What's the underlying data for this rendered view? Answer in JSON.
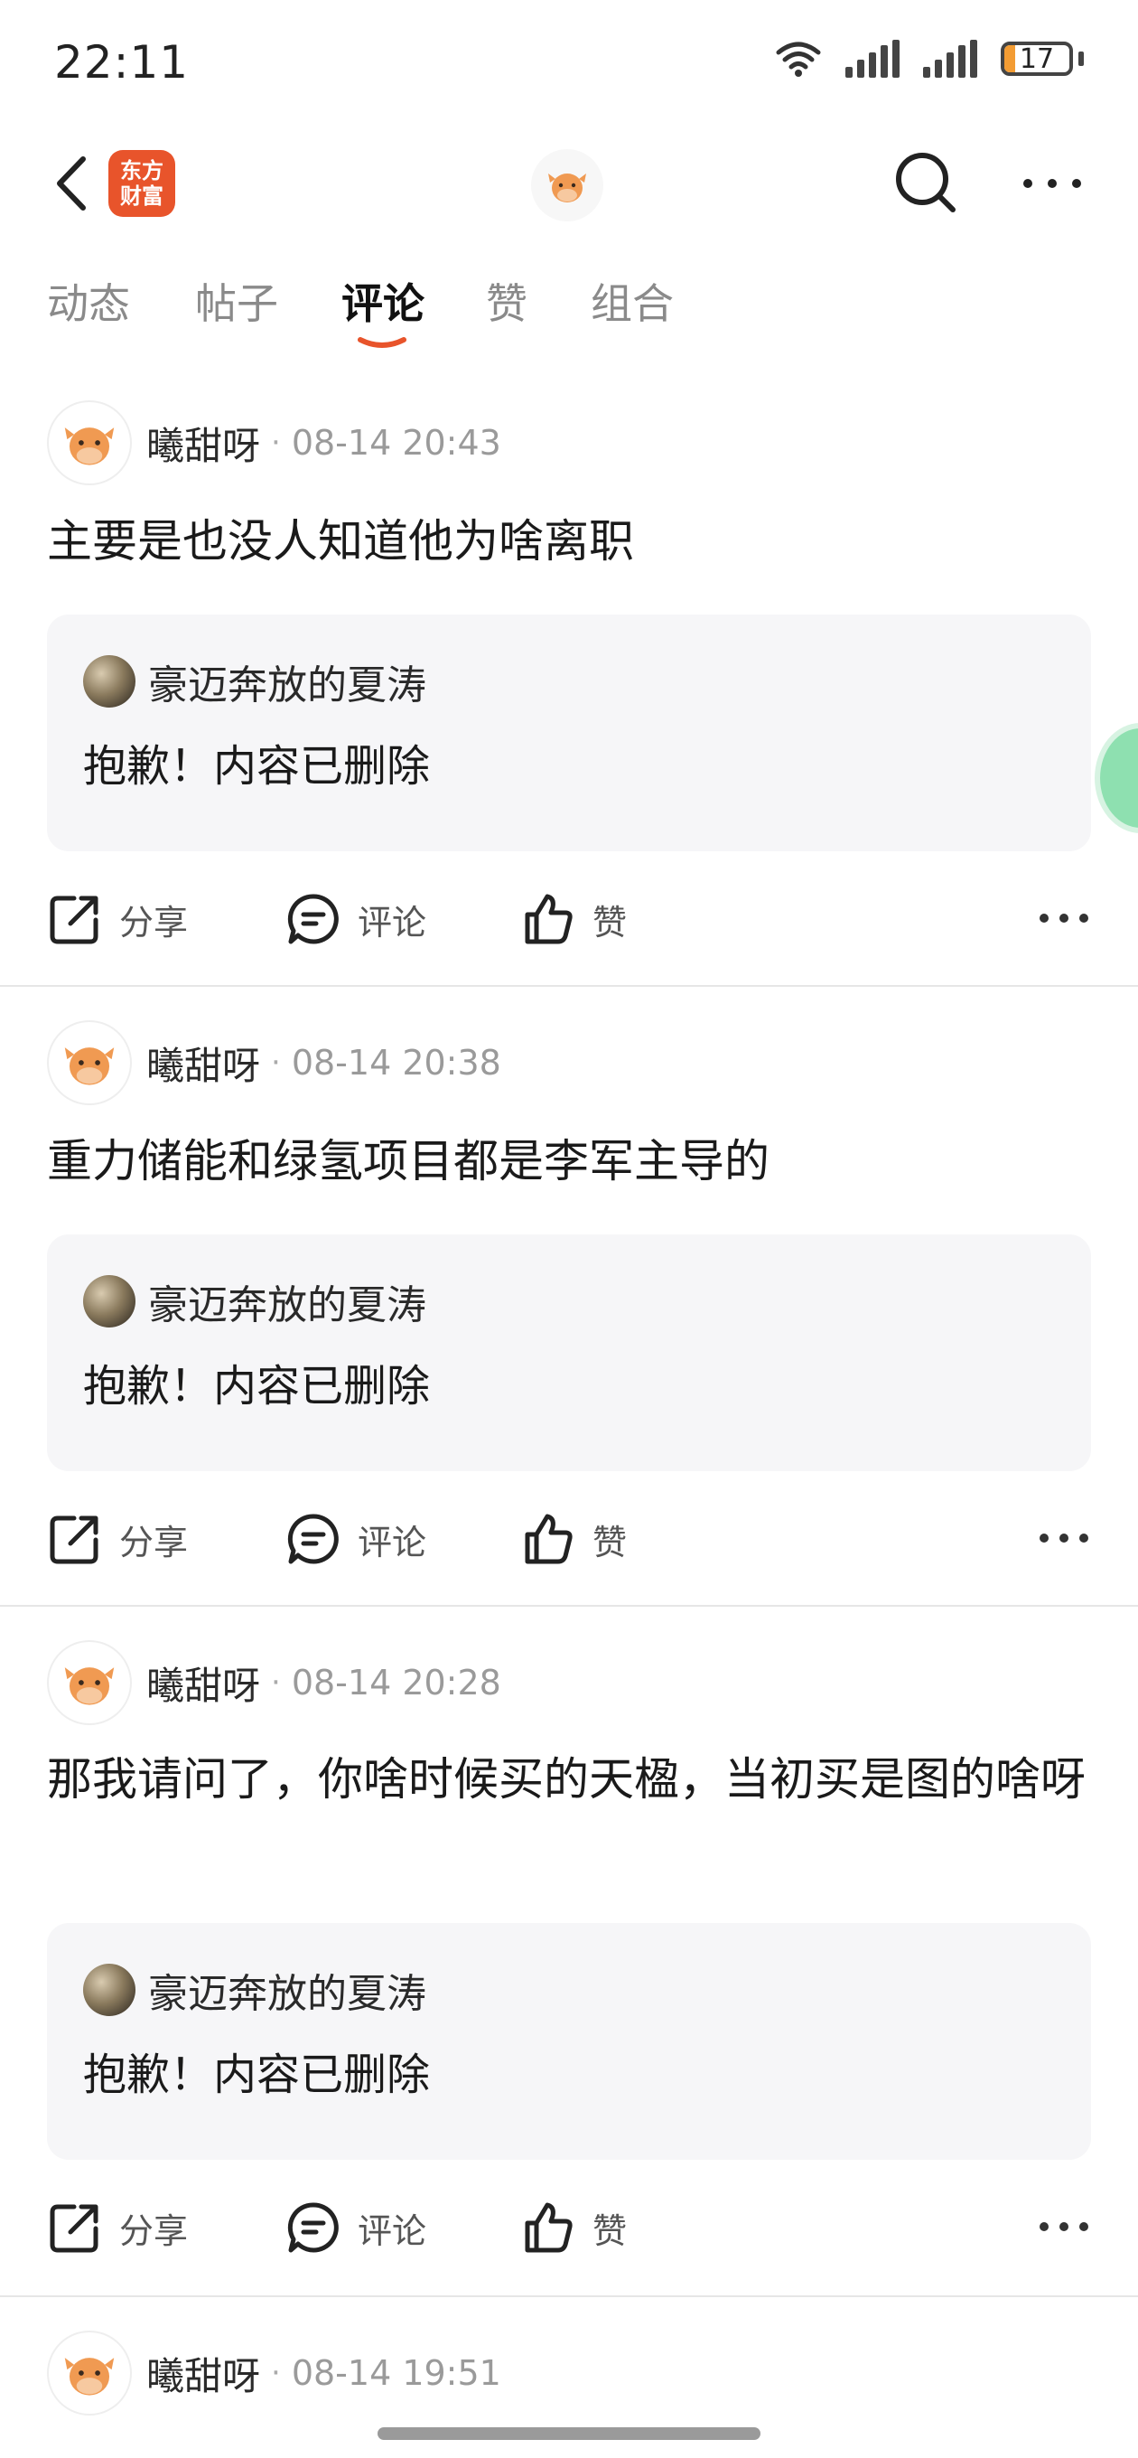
{
  "status_bar": {
    "time": "22:11",
    "battery": "17",
    "battery_fraction": 0.17
  },
  "nav": {
    "logo_line1": "东方",
    "logo_line2": "财富"
  },
  "tabs": [
    {
      "label": "动态",
      "active": false
    },
    {
      "label": "帖子",
      "active": false
    },
    {
      "label": "评论",
      "active": true
    },
    {
      "label": "赞",
      "active": false
    },
    {
      "label": "组合",
      "active": false
    }
  ],
  "actions": {
    "share": "分享",
    "comment": "评论",
    "like": "赞"
  },
  "posts": [
    {
      "user": "曦甜呀",
      "time": "08-14 20:43",
      "text": "主要是也没人知道他为啥离职",
      "quote": {
        "user": "豪迈奔放的夏涛",
        "text": "抱歉！内容已删除"
      }
    },
    {
      "user": "曦甜呀",
      "time": "08-14 20:38",
      "text": "重力储能和绿氢项目都是李军主导的",
      "quote": {
        "user": "豪迈奔放的夏涛",
        "text": "抱歉！内容已删除"
      }
    },
    {
      "user": "曦甜呀",
      "time": "08-14 20:28",
      "text": "那我请问了，你啥时候买的天楹，当初买是图的啥呀",
      "quote": {
        "user": "豪迈奔放的夏涛",
        "text": "抱歉！内容已删除"
      }
    },
    {
      "user": "曦甜呀",
      "time": "08-14 19:51"
    }
  ],
  "colors": {
    "accent": "#e8542b",
    "quote_bg": "#f6f6f8",
    "battery": "#f39c33"
  }
}
